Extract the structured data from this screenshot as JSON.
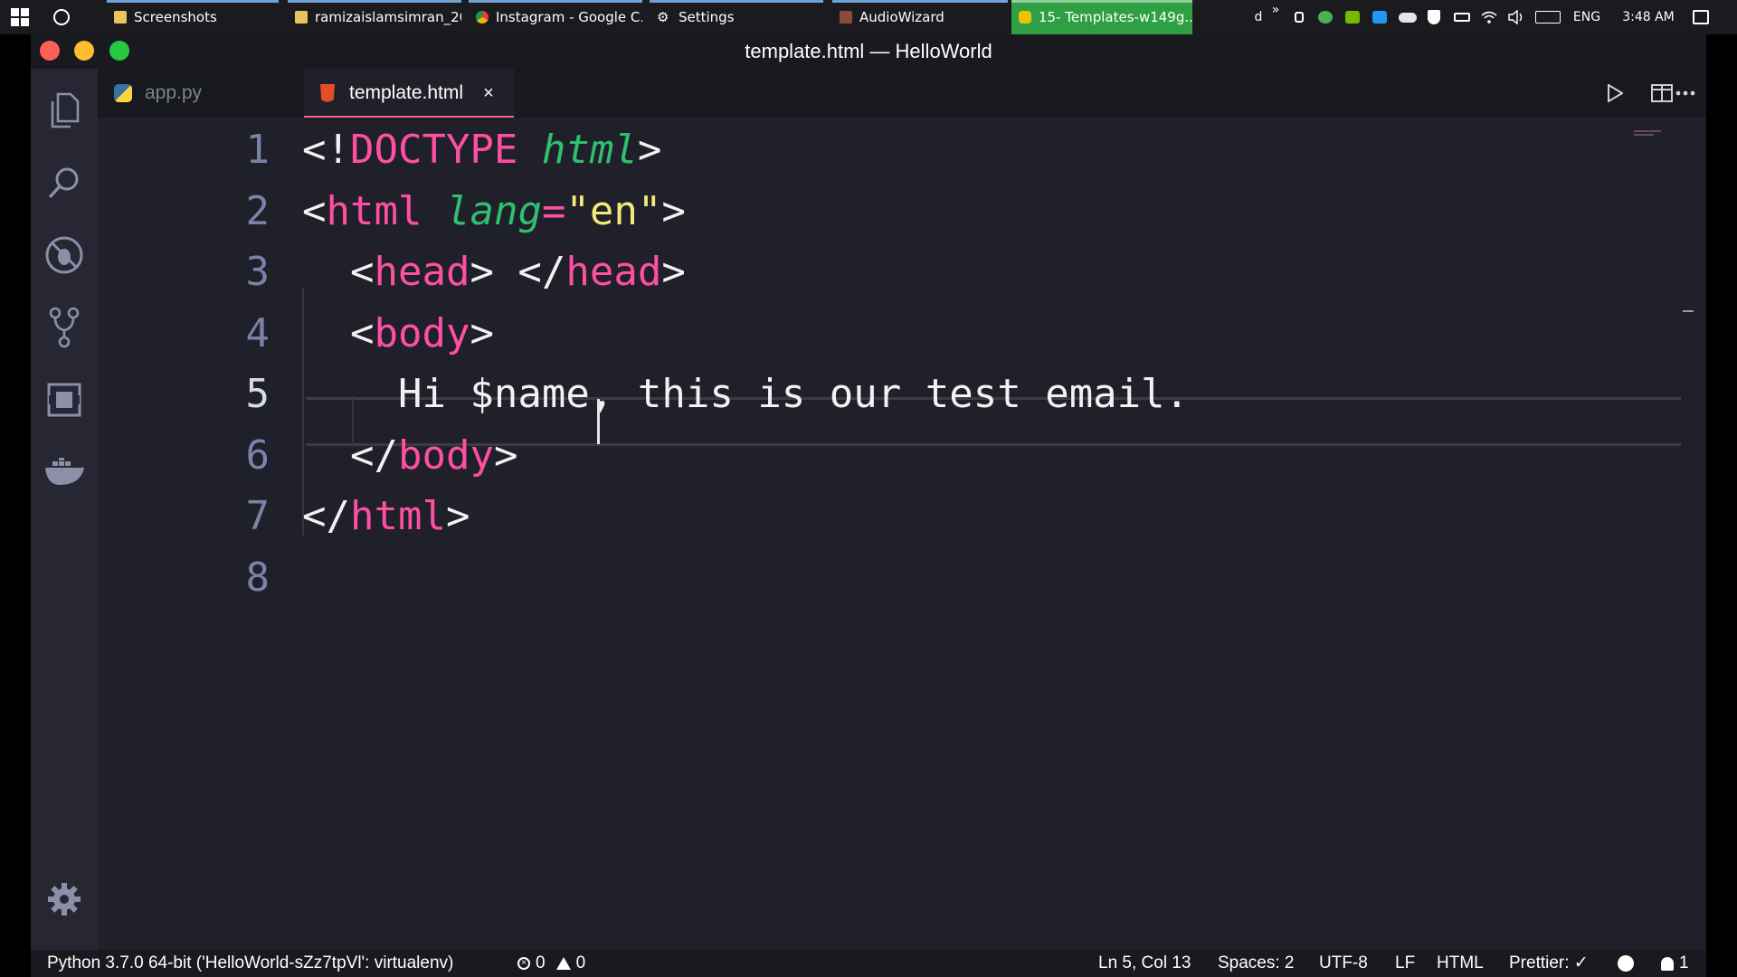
{
  "taskbar": {
    "tasks": [
      {
        "label": "Screenshots"
      },
      {
        "label": "ramizaislamsimran_20..."
      },
      {
        "label": "Instagram - Google C..."
      },
      {
        "label": "Settings"
      },
      {
        "label": "AudioWizard"
      },
      {
        "label": "15- Templates-w149g..."
      }
    ],
    "tray": {
      "d_label": "d",
      "overflow_label": "»",
      "language": "ENG",
      "time": "3:48 AM"
    }
  },
  "window": {
    "title": "template.html — HelloWorld"
  },
  "tabs": [
    {
      "label": "app.py",
      "active": false
    },
    {
      "label": "template.html",
      "active": true
    }
  ],
  "tab_close_glyph": "×",
  "editor": {
    "line_numbers": [
      "1",
      "2",
      "3",
      "4",
      "5",
      "6",
      "7",
      "8"
    ],
    "current_line": 5,
    "lines": [
      [
        {
          "t": "punc",
          "v": "<!"
        },
        {
          "t": "kw",
          "v": "DOCTYPE"
        },
        {
          "t": "punc",
          "v": " "
        },
        {
          "t": "attr",
          "v": "html"
        },
        {
          "t": "punc",
          "v": ">"
        }
      ],
      [
        {
          "t": "punc",
          "v": "<"
        },
        {
          "t": "kw",
          "v": "html"
        },
        {
          "t": "punc",
          "v": " "
        },
        {
          "t": "attr",
          "v": "lang"
        },
        {
          "t": "kw",
          "v": "="
        },
        {
          "t": "str",
          "v": "\"en\""
        },
        {
          "t": "punc",
          "v": ">"
        }
      ],
      [
        {
          "t": "punc",
          "v": "  <"
        },
        {
          "t": "kw",
          "v": "head"
        },
        {
          "t": "punc",
          "v": "> </"
        },
        {
          "t": "kw",
          "v": "head"
        },
        {
          "t": "punc",
          "v": ">"
        }
      ],
      [
        {
          "t": "punc",
          "v": "  <"
        },
        {
          "t": "kw",
          "v": "body"
        },
        {
          "t": "punc",
          "v": ">"
        }
      ],
      [
        {
          "t": "punc",
          "v": "    Hi $name, this is our test email."
        }
      ],
      [
        {
          "t": "punc",
          "v": "  </"
        },
        {
          "t": "kw",
          "v": "body"
        },
        {
          "t": "punc",
          "v": ">"
        }
      ],
      [
        {
          "t": "punc",
          "v": "</"
        },
        {
          "t": "kw",
          "v": "html"
        },
        {
          "t": "punc",
          "v": ">"
        }
      ],
      []
    ]
  },
  "statusbar": {
    "interpreter": "Python 3.7.0 64-bit ('HelloWorld-sZz7tpVl': virtualenv)",
    "errors": "0",
    "warnings": "0",
    "position": "Ln 5, Col 13",
    "spaces": "Spaces: 2",
    "encoding": "UTF-8",
    "eol": "LF",
    "language": "HTML",
    "prettier": "Prettier: ✓",
    "notifications": "1"
  },
  "colors": {
    "keyword": "#ff4fa3",
    "attribute": "#2fbf6e",
    "string": "#f5e87a",
    "editor_bg": "#20202a",
    "active_tab_accent": "#ff6188"
  },
  "icons": {
    "start": "windows-logo-icon",
    "search": "cortana-ring-icon",
    "explorer": "files-icon",
    "find": "search-icon",
    "debug": "no-bug-icon",
    "scm": "source-control-icon",
    "extensions": "extensions-icon",
    "docker": "docker-whale-icon",
    "settings": "gear-icon",
    "run": "play-icon",
    "split": "split-editor-icon",
    "more": "ellipsis-icon"
  }
}
